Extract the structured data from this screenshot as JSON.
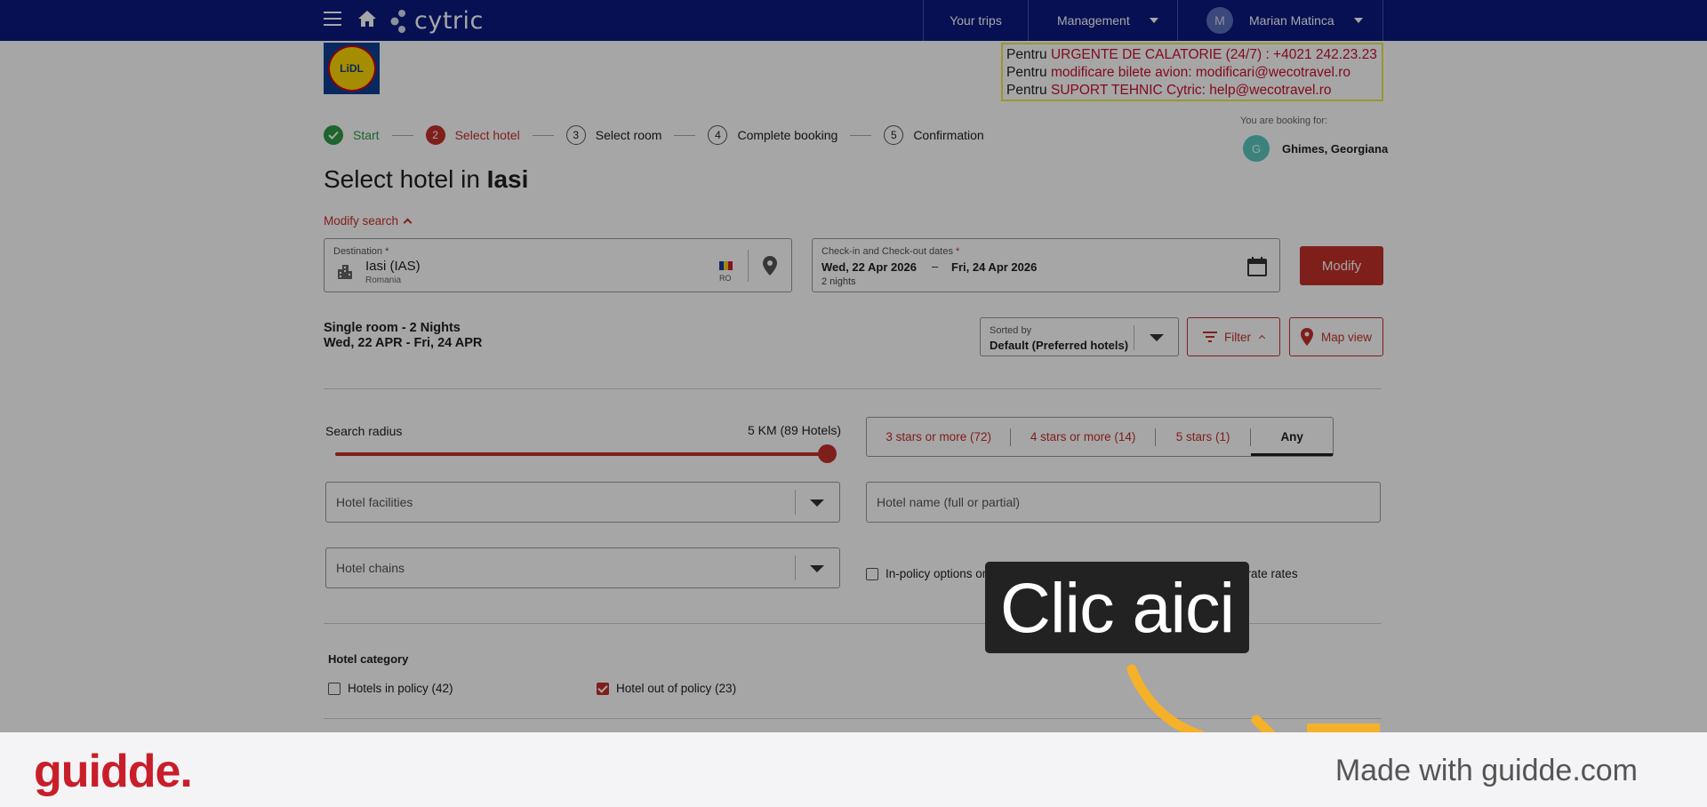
{
  "topbar": {
    "brand": "cytric",
    "nav_trips": "Your trips",
    "nav_management": "Management",
    "user_initial": "M",
    "user_name": "Marian Matinca"
  },
  "company_logo_text": "LiDL",
  "notice": {
    "line1_prefix": "Pentru ",
    "line1_red": "URGENTE DE CALATORIE (24/7) : +4021 242.23.23",
    "line2_prefix": "Pentru ",
    "line2_red": "modificare bilete avion:  modificari@wecotravel.ro",
    "line3_prefix": "Pentru ",
    "line3_red": "SUPORT TEHNIC Cytric:  help@wecotravel.ro"
  },
  "stepper": {
    "steps": [
      {
        "num": "1",
        "label": "Start",
        "state": "done"
      },
      {
        "num": "2",
        "label": "Select hotel",
        "state": "active"
      },
      {
        "num": "3",
        "label": "Select room",
        "state": "todo"
      },
      {
        "num": "4",
        "label": "Complete booking",
        "state": "todo"
      },
      {
        "num": "5",
        "label": "Confirmation",
        "state": "todo"
      }
    ]
  },
  "booking_for": {
    "label": "You are booking for:",
    "initial": "G",
    "name": "Ghimes, Georgiana"
  },
  "title": {
    "prefix": "Select hotel in ",
    "city": "Iasi"
  },
  "modify_search": "Modify search",
  "destination": {
    "label": "Destination *",
    "value": "Iasi (IAS)",
    "country": "Romania",
    "country_code": "RO"
  },
  "dates": {
    "label": "Check-in and Check-out dates",
    "required_mark": "*",
    "checkin": "Wed, 22 Apr 2026",
    "separator": "–",
    "checkout": "Fri, 24 Apr 2026",
    "nights": "2 nights"
  },
  "modify_button": "Modify",
  "summary": {
    "room": "Single room - 2 Nights",
    "dates": "Wed, 22 APR - Fri, 24 APR"
  },
  "sort": {
    "label": "Sorted by",
    "value": "Default (Preferred hotels)"
  },
  "filter_button": "Filter",
  "map_button": "Map view",
  "search_radius": {
    "label": "Search radius",
    "value": "5 KM (89 Hotels)",
    "level": 1.0
  },
  "star_filter": {
    "options": [
      "3 stars or more (72)",
      "4 stars or more (14)",
      "5 stars (1)",
      "Any"
    ],
    "selected": "Any"
  },
  "hotel_facilities_placeholder": "Hotel facilities",
  "hotel_chains_placeholder": "Hotel chains",
  "hotel_name_placeholder": "Hotel name (full or partial)",
  "in_policy_only": "In-policy options only",
  "corporate_rates": "Hotels with corporate rates",
  "hotel_category": {
    "title": "Hotel category",
    "in_policy": "Hotels in policy (42)",
    "out_of_policy": "Hotel out of policy (23)"
  },
  "callout": "Clic aici",
  "footer": {
    "logo": "guidde.",
    "made_with": "Made with guidde.com"
  },
  "colors": {
    "topbar": "#0a1a80",
    "accent_red": "#c4302b",
    "done_green": "#2e9a43",
    "arrow_yellow": "#f5b12a",
    "guidde_red": "#c81e2a"
  }
}
